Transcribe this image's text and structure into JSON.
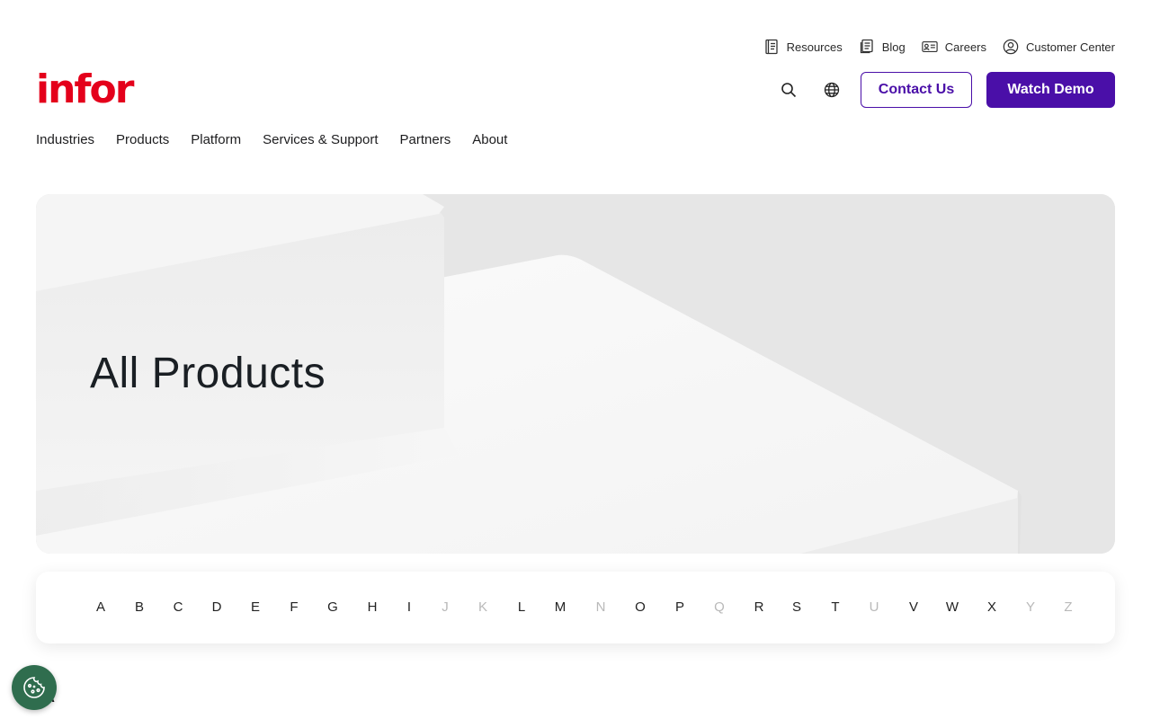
{
  "utility_nav": [
    {
      "label": "Resources",
      "icon": "book-icon"
    },
    {
      "label": "Blog",
      "icon": "document-stack-icon"
    },
    {
      "label": "Careers",
      "icon": "id-card-icon"
    },
    {
      "label": "Customer Center",
      "icon": "user-circle-icon"
    }
  ],
  "logo": {
    "text": "infor"
  },
  "header": {
    "contact_label": "Contact Us",
    "demo_label": "Watch Demo"
  },
  "main_nav": [
    "Industries",
    "Products",
    "Platform",
    "Services & Support",
    "Partners",
    "About"
  ],
  "hero": {
    "title": "All Products"
  },
  "alphabet": [
    {
      "letter": "A",
      "enabled": true
    },
    {
      "letter": "B",
      "enabled": true
    },
    {
      "letter": "C",
      "enabled": true
    },
    {
      "letter": "D",
      "enabled": true
    },
    {
      "letter": "E",
      "enabled": true
    },
    {
      "letter": "F",
      "enabled": true
    },
    {
      "letter": "G",
      "enabled": true
    },
    {
      "letter": "H",
      "enabled": true
    },
    {
      "letter": "I",
      "enabled": true
    },
    {
      "letter": "J",
      "enabled": false
    },
    {
      "letter": "K",
      "enabled": false
    },
    {
      "letter": "L",
      "enabled": true
    },
    {
      "letter": "M",
      "enabled": true
    },
    {
      "letter": "N",
      "enabled": false
    },
    {
      "letter": "O",
      "enabled": true
    },
    {
      "letter": "P",
      "enabled": true
    },
    {
      "letter": "Q",
      "enabled": false
    },
    {
      "letter": "R",
      "enabled": true
    },
    {
      "letter": "S",
      "enabled": true
    },
    {
      "letter": "T",
      "enabled": true
    },
    {
      "letter": "U",
      "enabled": false
    },
    {
      "letter": "V",
      "enabled": true
    },
    {
      "letter": "W",
      "enabled": true
    },
    {
      "letter": "X",
      "enabled": true
    },
    {
      "letter": "Y",
      "enabled": false
    },
    {
      "letter": "Z",
      "enabled": false
    }
  ],
  "section": {
    "first_letter": "A"
  },
  "colors": {
    "brand": "#e4001b",
    "accent": "#4a0fa8",
    "cookie": "#2f6d4e",
    "disabled": "#b9b9b9"
  }
}
